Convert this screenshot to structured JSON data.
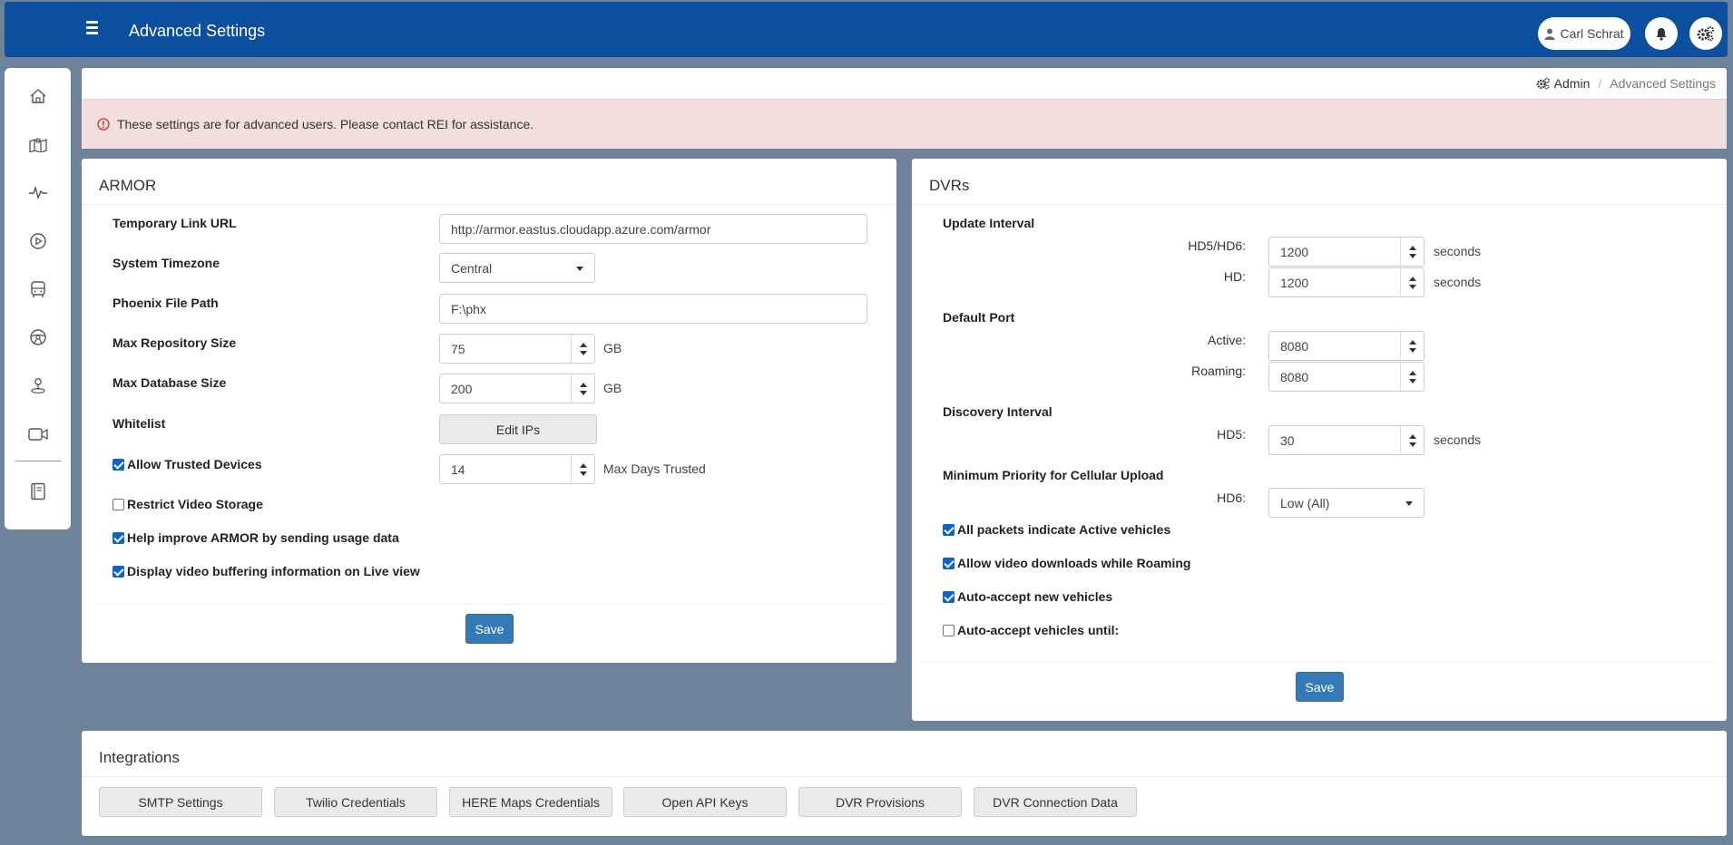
{
  "header": {
    "title": "Advanced Settings",
    "user_name": "Carl Schrat",
    "menu_icon": "hamburger-icon",
    "bell_icon": "bell-icon",
    "settings_icon": "gears-icon"
  },
  "sidebar": {
    "icons": [
      "home-icon",
      "map-icon",
      "activity-pulse-icon",
      "play-icon",
      "bus-icon",
      "steering-wheel-icon",
      "location-pin-icon",
      "video-camera-icon",
      "book-icon"
    ]
  },
  "breadcrumb": {
    "admin": "Admin",
    "current": "Advanced Settings"
  },
  "alert": {
    "text": "These settings are for advanced users. Please contact REI for assistance."
  },
  "armor": {
    "title": "ARMOR",
    "temp_link_label": "Temporary Link URL",
    "temp_link_value": "http://armor.eastus.cloudapp.azure.com/armor",
    "timezone_label": "System Timezone",
    "timezone_value": "Central",
    "phoenix_label": "Phoenix File Path",
    "phoenix_value": "F:\\phx",
    "max_repo_label": "Max Repository Size",
    "max_repo_value": "75",
    "max_repo_unit": "GB",
    "max_db_label": "Max Database Size",
    "max_db_value": "200",
    "max_db_unit": "GB",
    "whitelist_label": "Whitelist",
    "edit_ips_label": "Edit IPs",
    "trusted_label": "Allow Trusted Devices",
    "trusted_checked": true,
    "trusted_days_value": "14",
    "trusted_days_unit": "Max Days Trusted",
    "restrict_label": "Restrict Video Storage",
    "restrict_checked": false,
    "usage_label": "Help improve ARMOR by sending usage data",
    "usage_checked": true,
    "buffering_label": "Display video buffering information on Live view",
    "buffering_checked": true,
    "save_label": "Save"
  },
  "dvrs": {
    "title": "DVRs",
    "update_interval_label": "Update Interval",
    "hd5hd6_label": "HD5/HD6:",
    "hd5hd6_value": "1200",
    "hd_label": "HD:",
    "hd_value": "1200",
    "seconds_unit": "seconds",
    "default_port_label": "Default Port",
    "active_label": "Active:",
    "active_value": "8080",
    "roaming_label": "Roaming:",
    "roaming_value": "8080",
    "discovery_label": "Discovery Interval",
    "hd5_label": "HD5:",
    "hd5_value": "30",
    "min_priority_label": "Minimum Priority for Cellular Upload",
    "hd6_label": "HD6:",
    "hd6_value": "Low (All)",
    "all_packets_label": "All packets indicate Active vehicles",
    "all_packets_checked": true,
    "allow_downloads_label": "Allow video downloads while Roaming",
    "allow_downloads_checked": true,
    "auto_accept_label": "Auto-accept new vehicles",
    "auto_accept_checked": true,
    "auto_accept_until_label": "Auto-accept vehicles until:",
    "auto_accept_until_checked": false,
    "save_label": "Save"
  },
  "integrations": {
    "title": "Integrations",
    "buttons": [
      "SMTP Settings",
      "Twilio Credentials",
      "HERE Maps Credentials",
      "Open API Keys",
      "DVR Provisions",
      "DVR Connection Data"
    ]
  },
  "colors": {
    "header_bg": "#0c4f9e",
    "page_bg": "#6e8399",
    "alert_bg": "#f2dede",
    "primary_button": "#337ab7",
    "checkbox": "#0b63d0"
  }
}
